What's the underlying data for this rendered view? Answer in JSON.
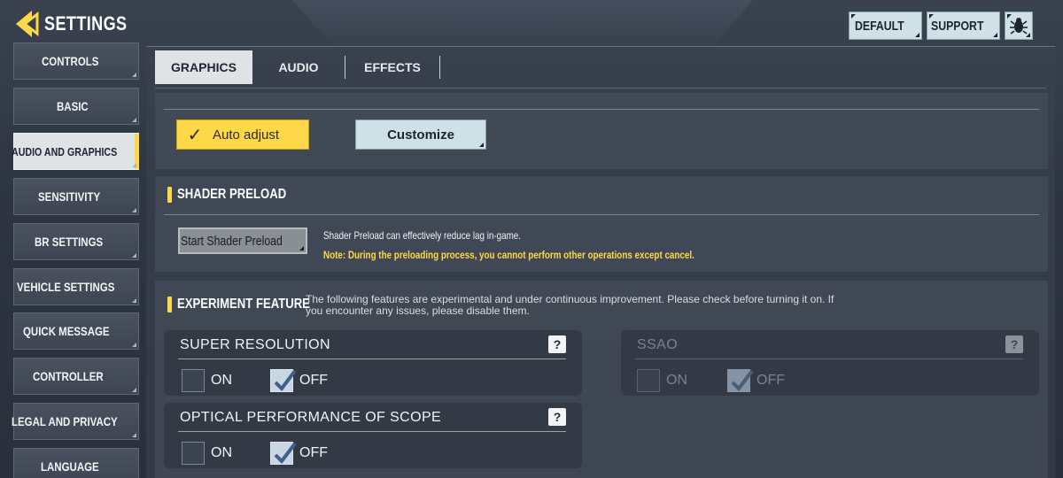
{
  "header": {
    "title": "SETTINGS",
    "default_label": "DEFAULT",
    "support_label": "SUPPORT"
  },
  "colors": {
    "accent_yellow": "#ffd84a",
    "button_light": "#cfe0e6",
    "active_light": "#dfe3e6"
  },
  "sidebar": {
    "items": [
      {
        "label": "CONTROLS"
      },
      {
        "label": "BASIC"
      },
      {
        "label": "AUDIO AND GRAPHICS"
      },
      {
        "label": "SENSITIVITY"
      },
      {
        "label": "BR SETTINGS"
      },
      {
        "label": "VEHICLE SETTINGS"
      },
      {
        "label": "QUICK MESSAGE"
      },
      {
        "label": "CONTROLLER"
      },
      {
        "label": "LEGAL AND PRIVACY"
      },
      {
        "label": "LANGUAGE"
      }
    ],
    "active_index": 2
  },
  "tabs": [
    {
      "label": "GRAPHICS"
    },
    {
      "label": "AUDIO"
    },
    {
      "label": "EFFECTS"
    }
  ],
  "graphics": {
    "auto_adjust_label": "Auto adjust",
    "customize_label": "Customize"
  },
  "shader": {
    "title": "SHADER PRELOAD",
    "button_label": "Start Shader Preload",
    "description": "Shader Preload can effectively reduce lag in-game.",
    "note": "Note: During the preloading process, you cannot perform other operations except cancel."
  },
  "experiment": {
    "title": "EXPERIMENT FEATURE",
    "description": "The following features are experimental and under continuous improvement. Please check before turning it on. If you encounter any issues, please disable them.",
    "features": [
      {
        "name": "SUPER RESOLUTION",
        "on_label": "ON",
        "off_label": "OFF",
        "value": "OFF",
        "enabled": true
      },
      {
        "name": "SSAO",
        "on_label": "ON",
        "off_label": "OFF",
        "value": "OFF",
        "enabled": false
      },
      {
        "name": "OPTICAL PERFORMANCE OF SCOPE",
        "on_label": "ON",
        "off_label": "OFF",
        "value": "OFF",
        "enabled": true
      }
    ]
  }
}
